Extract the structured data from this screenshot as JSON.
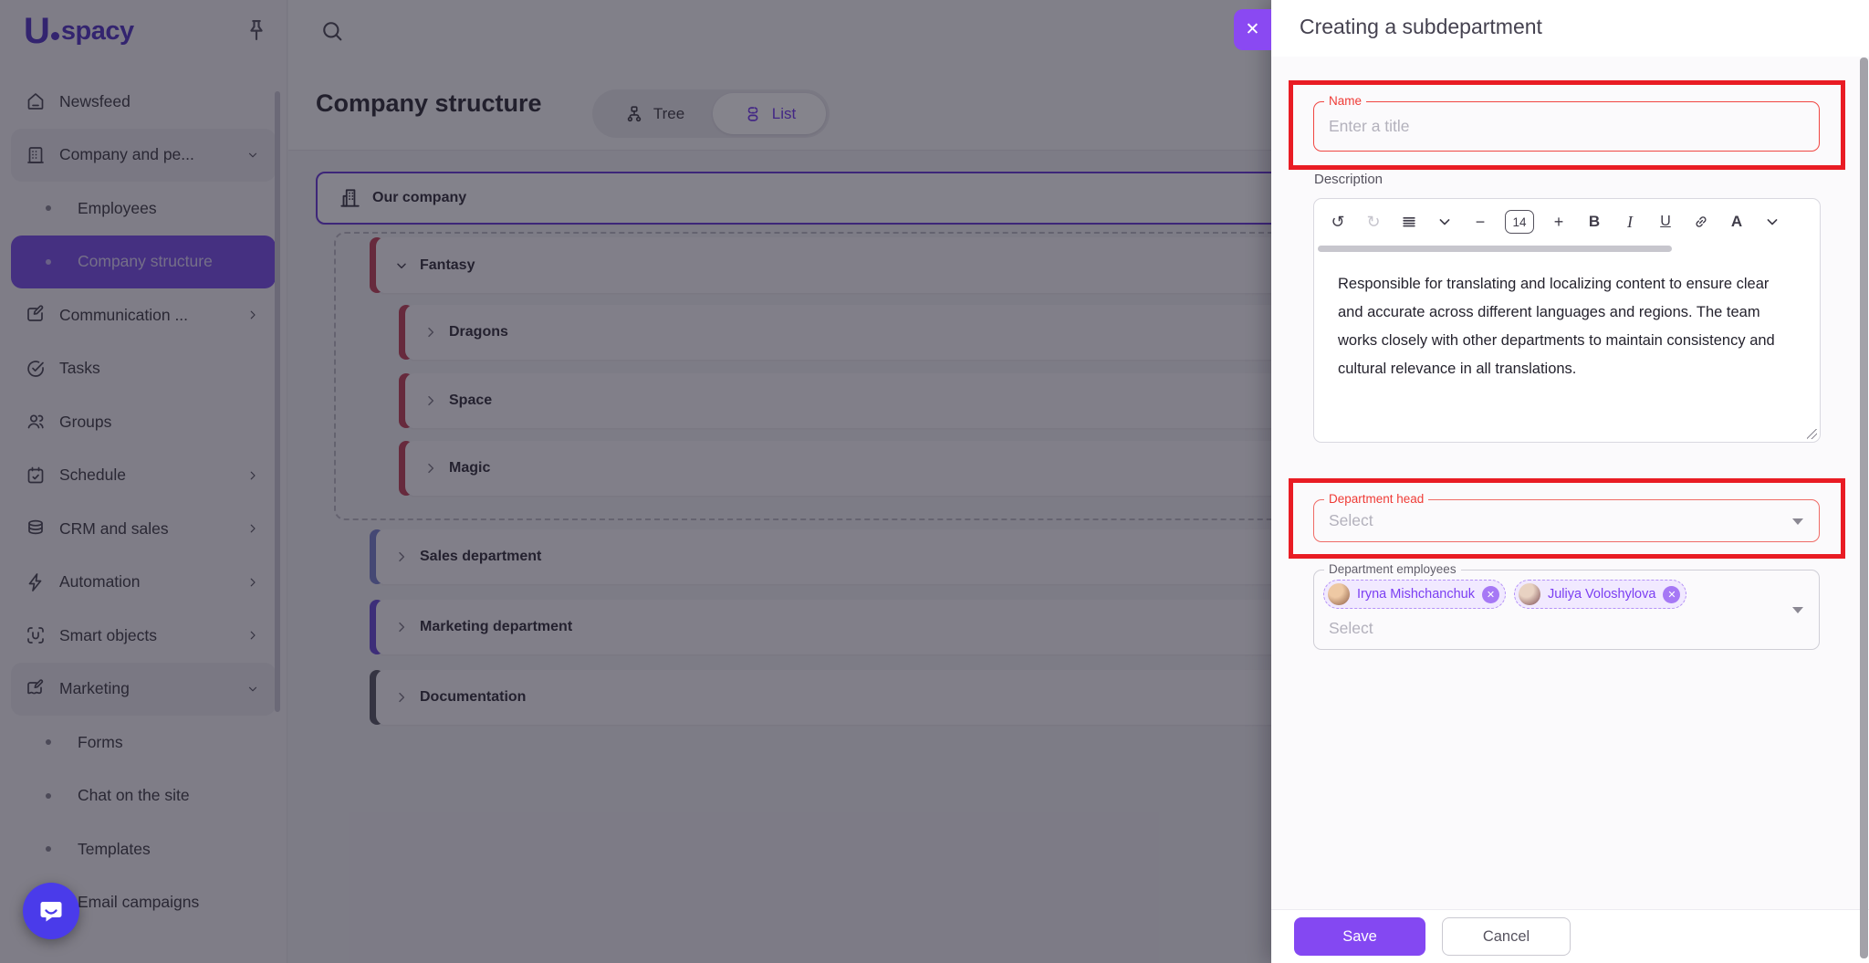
{
  "brand": {
    "name": "Uspacy",
    "logo_initial": "U",
    "logo_text": "spacy"
  },
  "topbar": {
    "search_icon": "search-icon",
    "pin_icon": "pin-icon"
  },
  "sidebar": {
    "items": [
      {
        "label": "Newsfeed",
        "icon": "home-icon"
      },
      {
        "label": "Company and pe...",
        "icon": "building-icon",
        "chevron": "down",
        "highlighted": true
      },
      {
        "label": "Employees",
        "sub": true
      },
      {
        "label": "Company structure",
        "sub": true,
        "active": true
      },
      {
        "label": "Communication ...",
        "icon": "communication-icon",
        "chevron": "right"
      },
      {
        "label": "Tasks",
        "icon": "tasks-icon"
      },
      {
        "label": "Groups",
        "icon": "groups-icon"
      },
      {
        "label": "Schedule",
        "icon": "schedule-icon",
        "chevron": "right"
      },
      {
        "label": "CRM and sales",
        "icon": "crm-icon",
        "chevron": "right"
      },
      {
        "label": "Automation",
        "icon": "automation-icon",
        "chevron": "right"
      },
      {
        "label": "Smart objects",
        "icon": "smart-objects-icon",
        "chevron": "right"
      },
      {
        "label": "Marketing",
        "icon": "marketing-icon",
        "chevron": "down",
        "highlighted": true
      },
      {
        "label": "Forms",
        "sub": true
      },
      {
        "label": "Chat on the site",
        "sub": true
      },
      {
        "label": "Templates",
        "sub": true
      },
      {
        "label": "Email campaigns",
        "sub": true
      }
    ]
  },
  "main": {
    "title": "Company structure",
    "view_toggle": {
      "tree_label": "Tree",
      "list_label": "List",
      "selected": "List"
    },
    "tree": {
      "rows": [
        {
          "label": "Our company",
          "type": "root"
        },
        {
          "label": "Fantasy",
          "accent": "#c24b60",
          "expanded": true
        },
        {
          "label": "Dragons",
          "accent": "#c24b60"
        },
        {
          "label": "Space",
          "accent": "#c24b60"
        },
        {
          "label": "Magic",
          "accent": "#c24b60"
        },
        {
          "label": "Sales department",
          "accent": "#7e87cf"
        },
        {
          "label": "Marketing department",
          "accent": "#6f52d8"
        },
        {
          "label": "Documentation",
          "accent": "#5f5f6a"
        }
      ]
    }
  },
  "modal": {
    "title": "Creating a subdepartment",
    "name_field": {
      "label": "Name",
      "placeholder": "Enter a title"
    },
    "description": {
      "label": "Description",
      "toolbar": {
        "font_size": "14",
        "buttons": [
          "undo",
          "redo",
          "align-justify",
          "chevron-down",
          "font-decrease",
          "font-size",
          "font-increase",
          "bold",
          "italic",
          "underline",
          "link",
          "text-color",
          "chevron-down-2"
        ]
      },
      "text": "Responsible for translating and localizing content to ensure clear and accurate across different languages and regions. The team works closely with other departments to maintain consistency and cultural relevance in all translations."
    },
    "department_head": {
      "label": "Department head",
      "placeholder": "Select"
    },
    "department_employees": {
      "label": "Department employees",
      "placeholder": "Select",
      "chips": [
        {
          "name": "Iryna Mishchanchuk"
        },
        {
          "name": "Juliya Voloshylova"
        }
      ]
    },
    "footer": {
      "save_label": "Save",
      "cancel_label": "Cancel"
    }
  },
  "colors": {
    "brand_purple": "#8448f2",
    "active_sidebar_item": "#7e57e8",
    "selected_border_purple": "#6f42d8",
    "error_red": "#f04642",
    "annotation_red": "#e91c24",
    "chip_purple": "#7b3ff2",
    "accent_red": "#c24b60",
    "accent_blue": "#7e87cf",
    "accent_purple": "#6f52d8",
    "accent_gray": "#5f5f6a",
    "scrim": "rgba(12,9,26,0.5)"
  }
}
